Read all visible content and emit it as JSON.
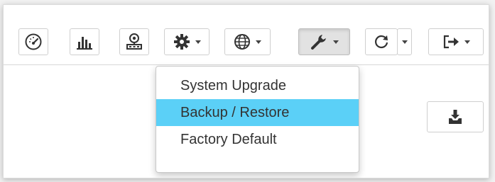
{
  "toolbar": {
    "buttons": [
      {
        "icon": "dashboard-icon"
      },
      {
        "icon": "bar-chart-icon"
      },
      {
        "icon": "network-icon"
      },
      {
        "icon": "gear-icon",
        "dropdown": true
      },
      {
        "icon": "globe-icon",
        "dropdown": true
      },
      {
        "icon": "wrench-icon",
        "dropdown": true,
        "active": true
      },
      {
        "icon": "refresh-icon",
        "split_dropdown": true
      },
      {
        "icon": "logout-icon",
        "dropdown": true
      }
    ]
  },
  "tools_menu": {
    "items": [
      {
        "label": "System Upgrade",
        "highlighted": false
      },
      {
        "label": "Backup / Restore",
        "highlighted": true
      },
      {
        "label": "Factory Default",
        "highlighted": false
      }
    ]
  },
  "content": {
    "download_button_icon": "download-tray-icon"
  },
  "colors": {
    "highlight": "#5bd0f7",
    "icon": "#333333",
    "border": "#cfcfcf"
  }
}
